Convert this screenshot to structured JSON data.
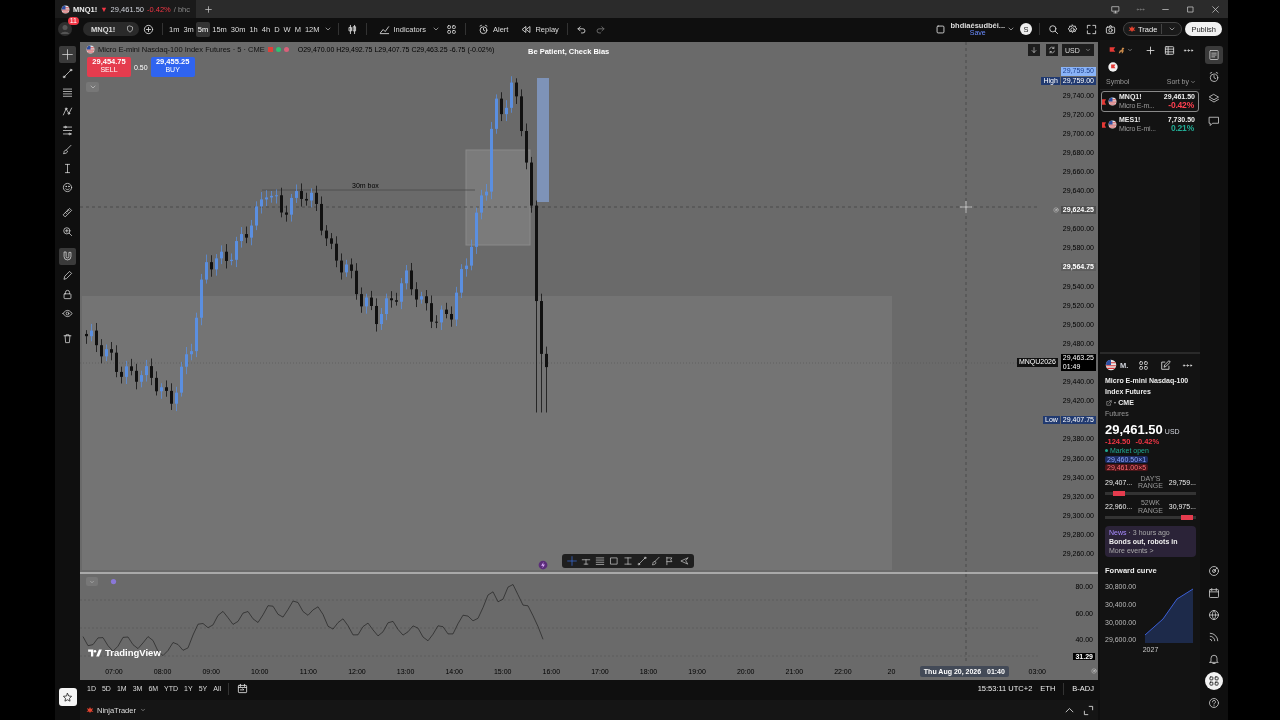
{
  "tab": {
    "symbol": "MNQ1!",
    "arrow": "▼",
    "price": "29,461.50",
    "change": "-0.42%",
    "suffix": "/ bhc"
  },
  "toolbar": {
    "badge": "11",
    "symbol": "MNQ1!",
    "intervals": [
      {
        "label": "1m",
        "selected": false
      },
      {
        "label": "3m",
        "selected": false
      },
      {
        "label": "5m",
        "selected": true
      },
      {
        "label": "15m",
        "selected": false
      },
      {
        "label": "30m",
        "selected": false
      },
      {
        "label": "1h",
        "selected": false
      },
      {
        "label": "4h",
        "selected": false
      },
      {
        "label": "D",
        "selected": false
      },
      {
        "label": "W",
        "selected": false
      },
      {
        "label": "M",
        "selected": false
      },
      {
        "label": "12M",
        "selected": false
      }
    ],
    "indicators": "Indicators",
    "alert": "Alert",
    "replay": "Replay",
    "layout_name": "bhdiaésudbéi...",
    "layout_status": "Save",
    "avatar": "S",
    "trade": "Trade",
    "publish": "Publish"
  },
  "tools": [
    {
      "selected": true
    },
    {
      "selected": false
    },
    {
      "selected": false
    },
    {
      "selected": false
    },
    {
      "selected": false
    },
    {
      "selected": false
    },
    {
      "selected": false
    },
    {
      "selected": false
    },
    {
      "selected": false
    },
    {
      "selected": false
    },
    {
      "selected": true
    },
    {
      "selected": false
    },
    {
      "selected": false
    },
    {
      "selected": false
    },
    {
      "selected": false
    }
  ],
  "chart": {
    "title": "Micro E-mini Nasdaq-100 Index Futures · 5 · CME",
    "status_marks": [
      {
        "kind": "square",
        "color": "#e0403a"
      },
      {
        "kind": "dot",
        "color": "#2fbf71"
      },
      {
        "kind": "dot",
        "color": "#d9607a"
      }
    ],
    "ohlc": "O29,470.00 H29,492.75 L29,407.75 C29,463.25 -6.75 (-0.02%)",
    "sell": {
      "price": "29,454.75",
      "label": "SELL"
    },
    "spread": "0.50",
    "buy": {
      "price": "29,455.25",
      "label": "BUY"
    },
    "note": "Be Patient, Check Bias",
    "box_label": "30m box",
    "currency": "USD",
    "price_axis": [
      {
        "kind": "highlight",
        "value": "29,759.50"
      },
      {
        "kind": "high",
        "label": "High",
        "value": "29,759.00"
      },
      {
        "kind": "tick",
        "value": "29,740.00"
      },
      {
        "kind": "tick",
        "value": "29,720.00"
      },
      {
        "kind": "tick",
        "value": "29,700.00"
      },
      {
        "kind": "tick",
        "value": "29,680.00"
      },
      {
        "kind": "tick",
        "value": "29,660.00"
      },
      {
        "kind": "tick",
        "value": "29,640.00"
      },
      {
        "kind": "crosshair",
        "value": "29,624.25"
      },
      {
        "kind": "tick",
        "value": "29,600.00"
      },
      {
        "kind": "tick",
        "value": "29,580.00"
      },
      {
        "kind": "marker",
        "value": "29,564.75"
      },
      {
        "kind": "tick",
        "value": "29,540.00"
      },
      {
        "kind": "tick",
        "value": "29,520.00"
      },
      {
        "kind": "tick",
        "value": "29,500.00"
      },
      {
        "kind": "tick",
        "value": "29,480.00"
      },
      {
        "kind": "current",
        "label": "MNQU2026",
        "value": "29,463.25",
        "countdown": "01:49"
      },
      {
        "kind": "tick",
        "value": "29,440.00"
      },
      {
        "kind": "tick",
        "value": "29,420.00"
      },
      {
        "kind": "low",
        "label": "Low",
        "value": "29,407.75"
      },
      {
        "kind": "tick",
        "value": "29,380.00"
      },
      {
        "kind": "tick",
        "value": "29,360.00"
      },
      {
        "kind": "tick",
        "value": "29,340.00"
      },
      {
        "kind": "tick",
        "value": "29,320.00"
      },
      {
        "kind": "tick",
        "value": "29,300.00"
      },
      {
        "kind": "tick",
        "value": "29,280.00"
      },
      {
        "kind": "tick",
        "value": "29,260.00"
      }
    ]
  },
  "oscillator": {
    "axis": [
      "80.00",
      "60.00",
      "40.00"
    ],
    "value": "31.29"
  },
  "brand": "TradingView",
  "time_axis": [
    {
      "kind": "tick",
      "label": "07:00"
    },
    {
      "kind": "tick",
      "label": "08:00"
    },
    {
      "kind": "tick",
      "label": "09:00"
    },
    {
      "kind": "tick",
      "label": "10:00"
    },
    {
      "kind": "tick",
      "label": "11:00"
    },
    {
      "kind": "tick",
      "label": "12:00"
    },
    {
      "kind": "tick",
      "label": "13:00"
    },
    {
      "kind": "tick",
      "label": "14:00"
    },
    {
      "kind": "tick",
      "label": "15:00"
    },
    {
      "kind": "tick",
      "label": "16:00"
    },
    {
      "kind": "tick",
      "label": "17:00"
    },
    {
      "kind": "tick",
      "label": "18:00"
    },
    {
      "kind": "tick",
      "label": "19:00"
    },
    {
      "kind": "tick",
      "label": "20:00"
    },
    {
      "kind": "tick",
      "label": "21:00"
    },
    {
      "kind": "tick",
      "label": "22:00"
    },
    {
      "kind": "tick",
      "label": "20"
    },
    {
      "kind": "crosshair",
      "label": "Thu Aug 20, 2026",
      "time": "01:40"
    },
    {
      "kind": "tick",
      "label": "03:00"
    }
  ],
  "bottom_bar": {
    "ranges": [
      "1D",
      "5D",
      "1M",
      "3M",
      "6M",
      "YTD",
      "1Y",
      "5Y",
      "All"
    ],
    "clock": "15:53:11 UTC+2",
    "session": "ETH",
    "adjustment": "B-ADJ"
  },
  "status_bar": {
    "broker": "NinjaTrader"
  },
  "watchlist": {
    "symbol_header": "Symbol",
    "sort": "Sort by",
    "rows": [
      {
        "symbol": "MNQ1!",
        "description": "Micro E-m...",
        "price": "29,461.50",
        "change": "-0.42%",
        "color": "#ff4050",
        "selected": true
      },
      {
        "symbol": "MES1!",
        "description": "Micro E-mi...",
        "price": "7,730.50",
        "change": "0.21%",
        "color": "#22ab94",
        "selected": false
      }
    ]
  },
  "details": {
    "symbol": "M.",
    "name": "Micro E-mini Nasdaq-100 Index Futures",
    "exchange": "· CME",
    "type": "Futures",
    "price": "29,461.50",
    "currency": "USD",
    "change": "-124.50",
    "change_pct": "-0.42%",
    "market_status": "Market open",
    "bid": "29,460.50×1",
    "ask": "29,461.00×5",
    "ranges": [
      {
        "low": "29,407...",
        "label": "DAY'S RANGE",
        "high": "29,759...",
        "level": 0.15
      },
      {
        "low": "22,960...",
        "label": "52WK RANGE",
        "high": "30,975...",
        "level": 0.9
      }
    ],
    "news": {
      "source": "News",
      "time": "· 3 hours ago",
      "headline": "Bonds out, robots in",
      "more": "More events >"
    },
    "forward_curve": {
      "title": "Forward curve",
      "y_labels": [
        "30,800.00",
        "30,400.00",
        "30,000.00",
        "29,600.00"
      ],
      "x_label": "2027"
    }
  },
  "side_icons": [
    {
      "selected": true
    },
    {
      "selected": false
    },
    {
      "selected": false
    },
    {
      "selected": false
    },
    {
      "selected": false
    },
    {
      "selected": false
    },
    {
      "selected": false
    },
    {
      "selected": false
    },
    {
      "selected": false
    },
    {
      "selected": true
    },
    {
      "selected": false
    }
  ]
}
